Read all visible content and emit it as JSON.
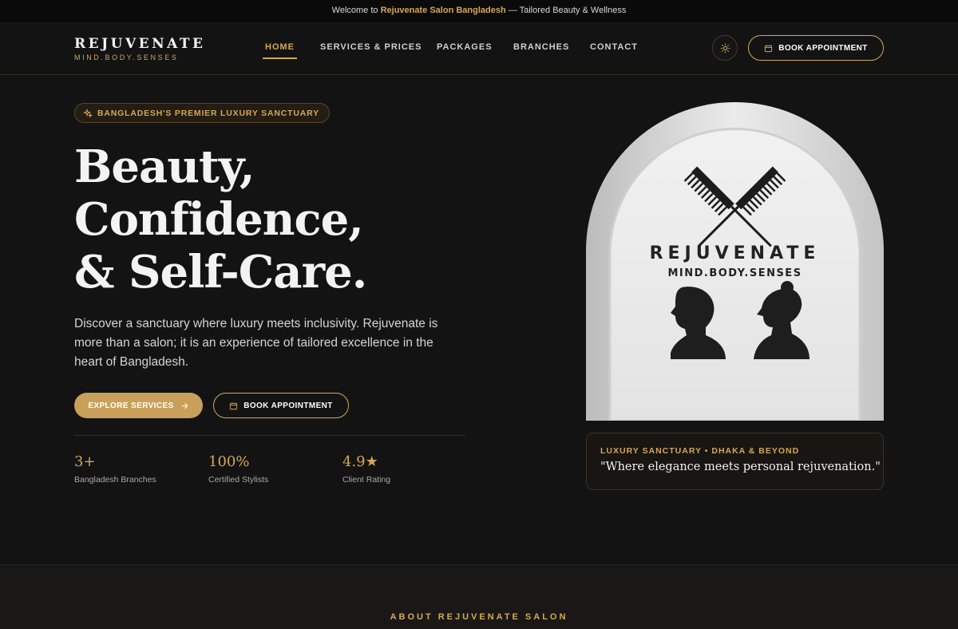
{
  "announcement": {
    "prefix": "Welcome to",
    "highlight": "Rejuvenate Salon Bangladesh",
    "suffix": "— Tailored Beauty & Wellness"
  },
  "brand": {
    "name": "REJUVENATE",
    "tagline": "MIND.BODY.SENSES"
  },
  "nav": {
    "items": [
      {
        "label": "HOME",
        "active": true
      },
      {
        "label": "SERVICES & PRICES",
        "active": false
      },
      {
        "label": "PACKAGES",
        "active": false
      },
      {
        "label": "BRANCHES",
        "active": false
      },
      {
        "label": "CONTACT",
        "active": false
      }
    ],
    "theme_icon": "sun-icon",
    "book_label": "BOOK APPOINTMENT"
  },
  "hero": {
    "badge": "BANGLADESH'S PREMIER LUXURY SANCTUARY",
    "title_lines": [
      "Beauty,",
      "Confidence,",
      "& Self-Care."
    ],
    "description": "Discover a sanctuary where luxury meets inclusivity. Rejuvenate is more than a salon; it is an experience of tailored excellence in the heart of Bangladesh.",
    "explore_label": "EXPLORE SERVICES",
    "book_label": "BOOK APPOINTMENT",
    "stats": [
      {
        "value": "3+",
        "label": "Bangladesh Branches"
      },
      {
        "value": "100%",
        "label": "Certified Stylists"
      },
      {
        "value": "4.9★",
        "label": "Client Rating"
      }
    ]
  },
  "feature_image": {
    "sign_name": "REJUVENATE",
    "sign_tagline": "MIND.BODY.SENSES"
  },
  "quote_card": {
    "tag": "LUXURY SANCTUARY • DHAKA & BEYOND",
    "quote": "\"Where elegance meets personal rejuvenation.\""
  },
  "about": {
    "label": "ABOUT REJUVENATE SALON"
  },
  "colors": {
    "background": "#131313",
    "accent": "#d4a857",
    "button_fill": "#c9a05a"
  }
}
